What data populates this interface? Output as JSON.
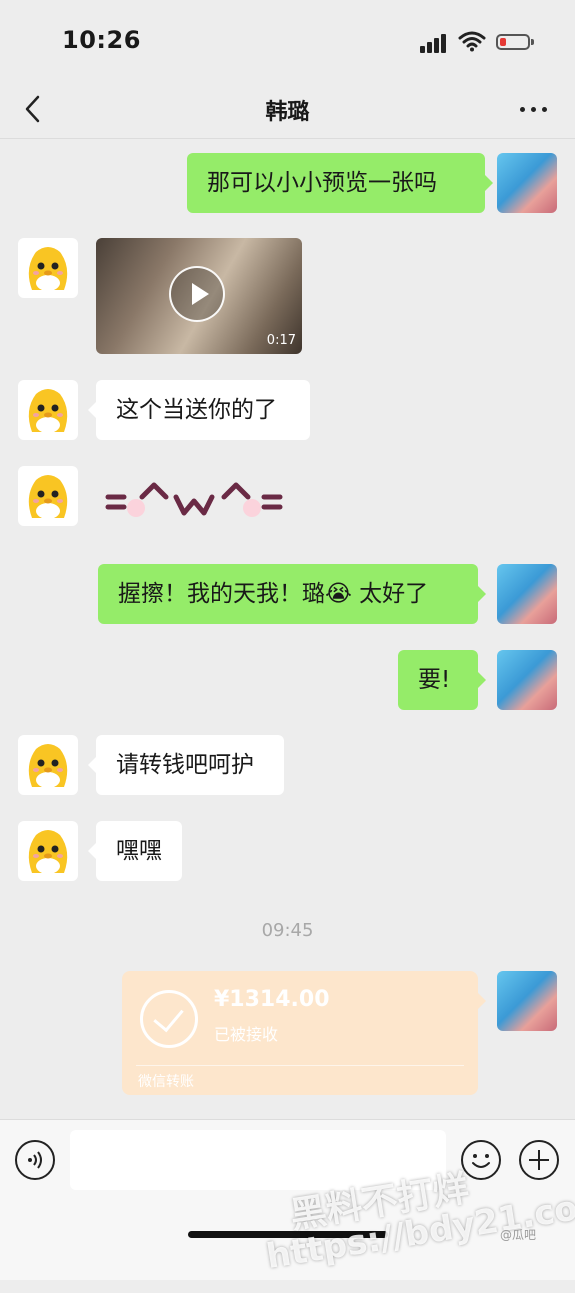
{
  "status_bar": {
    "time": "10:26"
  },
  "nav": {
    "title": "韩璐"
  },
  "messages": [
    {
      "from": "self",
      "text": "那可以小小预览一张吗"
    },
    {
      "from": "contact",
      "type": "video",
      "duration": "0:17"
    },
    {
      "from": "contact",
      "text": "这个当送你的了"
    },
    {
      "from": "contact",
      "type": "sticker",
      "kaomoji": "=^w^="
    },
    {
      "from": "self",
      "text": "握擦！我的天我！璐😭 太好了"
    },
    {
      "from": "self",
      "text": "要!"
    },
    {
      "from": "contact",
      "text": "请转钱吧呵护"
    },
    {
      "from": "contact",
      "text": "嘿嘿"
    }
  ],
  "timestamp": "09:45",
  "transfer": {
    "amount": "¥1314.00",
    "status": "已被接收",
    "source": "微信转账",
    "color": "#fde6cc"
  },
  "input": {
    "placeholder": ""
  },
  "icons": {
    "back": "back-chevron-icon",
    "more": "more-dots-icon",
    "voice": "voice-icon",
    "emoji": "emoji-icon",
    "plus": "plus-icon"
  },
  "colors": {
    "outgoing_bubble": "#95ec69",
    "incoming_bubble": "#ffffff",
    "background": "#ededed"
  },
  "watermark": {
    "line1": "黑料不打烊",
    "line2": "https://bdy21.co",
    "tag": "@瓜吧"
  }
}
